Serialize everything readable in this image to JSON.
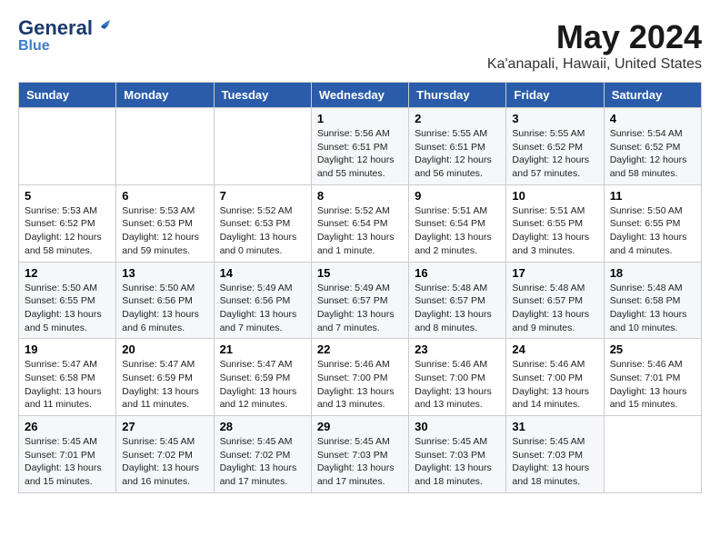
{
  "header": {
    "logo_general": "General",
    "logo_blue": "Blue",
    "month_title": "May 2024",
    "location": "Ka'anapali, Hawaii, United States"
  },
  "weekdays": [
    "Sunday",
    "Monday",
    "Tuesday",
    "Wednesday",
    "Thursday",
    "Friday",
    "Saturday"
  ],
  "weeks": [
    [
      {
        "day": "",
        "info": ""
      },
      {
        "day": "",
        "info": ""
      },
      {
        "day": "",
        "info": ""
      },
      {
        "day": "1",
        "info": "Sunrise: 5:56 AM\nSunset: 6:51 PM\nDaylight: 12 hours\nand 55 minutes."
      },
      {
        "day": "2",
        "info": "Sunrise: 5:55 AM\nSunset: 6:51 PM\nDaylight: 12 hours\nand 56 minutes."
      },
      {
        "day": "3",
        "info": "Sunrise: 5:55 AM\nSunset: 6:52 PM\nDaylight: 12 hours\nand 57 minutes."
      },
      {
        "day": "4",
        "info": "Sunrise: 5:54 AM\nSunset: 6:52 PM\nDaylight: 12 hours\nand 58 minutes."
      }
    ],
    [
      {
        "day": "5",
        "info": "Sunrise: 5:53 AM\nSunset: 6:52 PM\nDaylight: 12 hours\nand 58 minutes."
      },
      {
        "day": "6",
        "info": "Sunrise: 5:53 AM\nSunset: 6:53 PM\nDaylight: 12 hours\nand 59 minutes."
      },
      {
        "day": "7",
        "info": "Sunrise: 5:52 AM\nSunset: 6:53 PM\nDaylight: 13 hours\nand 0 minutes."
      },
      {
        "day": "8",
        "info": "Sunrise: 5:52 AM\nSunset: 6:54 PM\nDaylight: 13 hours\nand 1 minute."
      },
      {
        "day": "9",
        "info": "Sunrise: 5:51 AM\nSunset: 6:54 PM\nDaylight: 13 hours\nand 2 minutes."
      },
      {
        "day": "10",
        "info": "Sunrise: 5:51 AM\nSunset: 6:55 PM\nDaylight: 13 hours\nand 3 minutes."
      },
      {
        "day": "11",
        "info": "Sunrise: 5:50 AM\nSunset: 6:55 PM\nDaylight: 13 hours\nand 4 minutes."
      }
    ],
    [
      {
        "day": "12",
        "info": "Sunrise: 5:50 AM\nSunset: 6:55 PM\nDaylight: 13 hours\nand 5 minutes."
      },
      {
        "day": "13",
        "info": "Sunrise: 5:50 AM\nSunset: 6:56 PM\nDaylight: 13 hours\nand 6 minutes."
      },
      {
        "day": "14",
        "info": "Sunrise: 5:49 AM\nSunset: 6:56 PM\nDaylight: 13 hours\nand 7 minutes."
      },
      {
        "day": "15",
        "info": "Sunrise: 5:49 AM\nSunset: 6:57 PM\nDaylight: 13 hours\nand 7 minutes."
      },
      {
        "day": "16",
        "info": "Sunrise: 5:48 AM\nSunset: 6:57 PM\nDaylight: 13 hours\nand 8 minutes."
      },
      {
        "day": "17",
        "info": "Sunrise: 5:48 AM\nSunset: 6:57 PM\nDaylight: 13 hours\nand 9 minutes."
      },
      {
        "day": "18",
        "info": "Sunrise: 5:48 AM\nSunset: 6:58 PM\nDaylight: 13 hours\nand 10 minutes."
      }
    ],
    [
      {
        "day": "19",
        "info": "Sunrise: 5:47 AM\nSunset: 6:58 PM\nDaylight: 13 hours\nand 11 minutes."
      },
      {
        "day": "20",
        "info": "Sunrise: 5:47 AM\nSunset: 6:59 PM\nDaylight: 13 hours\nand 11 minutes."
      },
      {
        "day": "21",
        "info": "Sunrise: 5:47 AM\nSunset: 6:59 PM\nDaylight: 13 hours\nand 12 minutes."
      },
      {
        "day": "22",
        "info": "Sunrise: 5:46 AM\nSunset: 7:00 PM\nDaylight: 13 hours\nand 13 minutes."
      },
      {
        "day": "23",
        "info": "Sunrise: 5:46 AM\nSunset: 7:00 PM\nDaylight: 13 hours\nand 13 minutes."
      },
      {
        "day": "24",
        "info": "Sunrise: 5:46 AM\nSunset: 7:00 PM\nDaylight: 13 hours\nand 14 minutes."
      },
      {
        "day": "25",
        "info": "Sunrise: 5:46 AM\nSunset: 7:01 PM\nDaylight: 13 hours\nand 15 minutes."
      }
    ],
    [
      {
        "day": "26",
        "info": "Sunrise: 5:45 AM\nSunset: 7:01 PM\nDaylight: 13 hours\nand 15 minutes."
      },
      {
        "day": "27",
        "info": "Sunrise: 5:45 AM\nSunset: 7:02 PM\nDaylight: 13 hours\nand 16 minutes."
      },
      {
        "day": "28",
        "info": "Sunrise: 5:45 AM\nSunset: 7:02 PM\nDaylight: 13 hours\nand 17 minutes."
      },
      {
        "day": "29",
        "info": "Sunrise: 5:45 AM\nSunset: 7:03 PM\nDaylight: 13 hours\nand 17 minutes."
      },
      {
        "day": "30",
        "info": "Sunrise: 5:45 AM\nSunset: 7:03 PM\nDaylight: 13 hours\nand 18 minutes."
      },
      {
        "day": "31",
        "info": "Sunrise: 5:45 AM\nSunset: 7:03 PM\nDaylight: 13 hours\nand 18 minutes."
      },
      {
        "day": "",
        "info": ""
      }
    ]
  ]
}
